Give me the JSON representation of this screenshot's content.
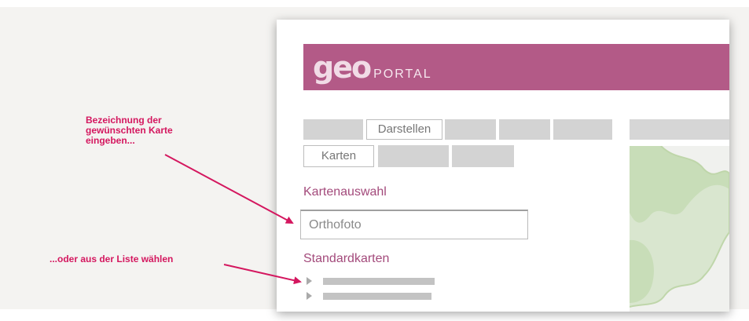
{
  "annotations": {
    "type_name": "Bezeichnung der\ngewünschten Karte\neingeben...",
    "choose_list": "...oder aus der Liste wählen"
  },
  "header": {
    "logo_geo": "geo",
    "logo_portal": "PORTAL"
  },
  "tabs": {
    "row1_active": "Darstellen",
    "row2_active": "Karten"
  },
  "sections": {
    "map_selection": "Kartenauswahl",
    "standard_maps": "Standardkarten"
  },
  "search": {
    "value": "Orthofoto"
  },
  "colors": {
    "accent": "#d4175f",
    "banner": "#b35a87",
    "section_title": "#a34a7b",
    "map_green": "#c8ddb8"
  }
}
